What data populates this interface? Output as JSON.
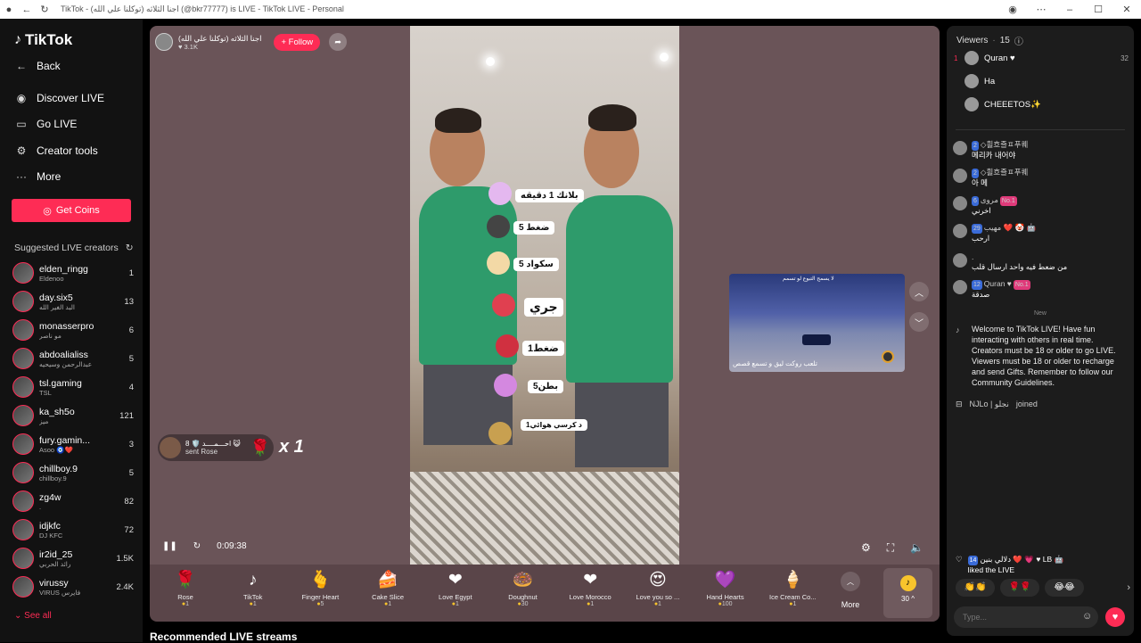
{
  "browser": {
    "tab_title": "TikTok - اجنا الثلاثه (توكلنا علي الله) (@bkr77777) is LIVE - TikTok LIVE - Personal"
  },
  "sidebar": {
    "logo": "TikTok",
    "back": "Back",
    "nav": [
      {
        "label": "Discover LIVE",
        "icon": "broadcast-icon"
      },
      {
        "label": "Go LIVE",
        "icon": "camera-icon"
      },
      {
        "label": "Creator tools",
        "icon": "tools-icon"
      },
      {
        "label": "More",
        "icon": "more-dots-icon"
      }
    ],
    "get_coins": "Get Coins",
    "suggested_title": "Suggested LIVE creators",
    "creators": [
      {
        "name": "elden_ringg",
        "sub": "Eldenoo",
        "count": "1"
      },
      {
        "name": "day.six5",
        "sub": "البد الغير الله",
        "count": "13"
      },
      {
        "name": "monasserpro",
        "sub": "مو ناصر",
        "count": "6"
      },
      {
        "name": "abdoalialiss",
        "sub": "عبدالرحمن وسيحيه",
        "count": "5"
      },
      {
        "name": "tsl.gaming",
        "sub": "TSL",
        "count": "4"
      },
      {
        "name": "ka_sh5o",
        "sub": "ميز",
        "count": "121"
      },
      {
        "name": "fury.gamin...",
        "sub": "Asoo 🧿❤️",
        "count": "3"
      },
      {
        "name": "chillboy.9",
        "sub": "chillboy.9",
        "count": "5"
      },
      {
        "name": "zg4w",
        "sub": ".",
        "count": "82"
      },
      {
        "name": "idjkfc",
        "sub": "DJ KFC",
        "count": "72"
      },
      {
        "name": "ir2id_25",
        "sub": "رائد الحربي",
        "count": "1.5K"
      },
      {
        "name": "virussy",
        "sub": "VIRUS فايرس",
        "count": "2.4K"
      }
    ],
    "see_all": "See all"
  },
  "stage": {
    "host_name": "اجنا الثلاثه (توكلنا علي الله)",
    "host_likes": "♥ 3.1K",
    "follow": "+ Follow",
    "exercises": [
      {
        "label": "بلانك 1 دقيقه"
      },
      {
        "label": "5  ضغط"
      },
      {
        "label": "5  سكواد"
      },
      {
        "label": "جري"
      },
      {
        "label": "1ضغط"
      },
      {
        "label": "5بطن"
      },
      {
        "label": "1د كرسي هوائي"
      }
    ],
    "gift_sender": "احـــمــــد 🛡️ 8 😺",
    "gift_action": "sent Rose",
    "gift_multiplier": "x 1",
    "mini_caption": "تلعب روكت ليق و تسمع قصص",
    "mini_top": "لا يسمح التبوع لو تسمم",
    "time": "0:09:38"
  },
  "gifts": [
    {
      "name": "Rose",
      "price": "1",
      "icon": "🌹"
    },
    {
      "name": "TikTok",
      "price": "1",
      "icon": "♪"
    },
    {
      "name": "Finger Heart",
      "price": "5",
      "icon": "🫰"
    },
    {
      "name": "Cake Slice",
      "price": "1",
      "icon": "🍰"
    },
    {
      "name": "Love Egypt",
      "price": "1",
      "icon": "❤"
    },
    {
      "name": "Doughnut",
      "price": "30",
      "icon": "🍩"
    },
    {
      "name": "Love Morocco",
      "price": "1",
      "icon": "❤"
    },
    {
      "name": "Love you so ...",
      "price": "1",
      "icon": "😍"
    },
    {
      "name": "Hand Hearts",
      "price": "100",
      "icon": "💜"
    },
    {
      "name": "Ice Cream Co...",
      "price": "1",
      "icon": "🍦"
    }
  ],
  "gift_more": "More",
  "coin_balance": "30",
  "recommended_title": "Recommended LIVE streams",
  "panel": {
    "viewers_label": "Viewers",
    "viewers_count": "15",
    "top_viewers": [
      {
        "rank": "1",
        "name": "Quran ♥",
        "score": "32"
      },
      {
        "rank": "",
        "name": "Ha",
        "score": ""
      },
      {
        "rank": "",
        "name": "CHEEETOS✨",
        "score": ""
      }
    ],
    "chats": [
      {
        "name": "◇흴흐즐ㅍ푸퀘",
        "level": "2",
        "fan": "",
        "msg": "메리카 내어야"
      },
      {
        "name": "◇흴흐즐ㅍ푸퀘",
        "level": "2",
        "fan": "",
        "msg": "아 메"
      },
      {
        "name": "مروى",
        "level": "6",
        "fan": "No.1",
        "msg": "اخرني"
      },
      {
        "name": "مهيب ❤️ 🤡 🤖",
        "level": "29",
        "fan": "",
        "msg": "ارحب"
      },
      {
        "name": ".",
        "level": "",
        "fan": "",
        "msg": "من ضعط فيه واحد ارسال قلب"
      },
      {
        "name": "Quran ♥",
        "level": "12",
        "fan": "No.1",
        "msg": "صدقة"
      }
    ],
    "new_label": "New",
    "welcome": "Welcome to TikTok LIVE! Have fun interacting with others in real time. Creators must be 18 or older to go LIVE. Viewers must be 18 or older to recharge and send Gifts. Remember to follow our Community Guidelines.",
    "joined_user": "NJLo | نجلو",
    "joined_text": "joined",
    "liked_user": "دلالي بنين ❤️ 💗 ♥ LB 🤖",
    "liked_level": "14",
    "liked_text": "liked the LIVE",
    "reactions": [
      "👏👏",
      "🌹🌹",
      "😂😂"
    ],
    "input_placeholder": "Type..."
  }
}
